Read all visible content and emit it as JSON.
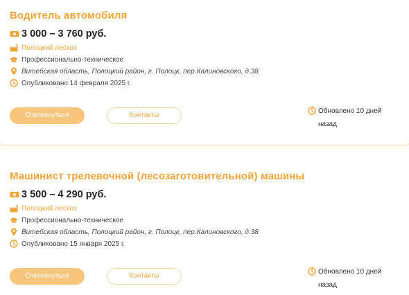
{
  "colors": {
    "accent": "#f0a53a",
    "button_fill": "#f7c57b",
    "border": "#f0d9a8"
  },
  "vacancies": [
    {
      "title": "Водитель автомобиля",
      "salary": "3 000 – 3 760 руб.",
      "company": "Полоцкий лесхоз",
      "education": "Профессионально-техническое",
      "address": "Витебская область, Полоцкий район, г. Полоцк, пер.Калиновского, д.38",
      "published": "Опубликовано 14 февраля 2025 г.",
      "apply_label": "Откликнуться",
      "contacts_label": "Контакты",
      "updated_line1": "Обновлено 10 дней",
      "updated_line2": "назад"
    },
    {
      "title": "Машинист трелевочной (лесозаготовительной) машины",
      "salary": "3 500 – 4 290 руб.",
      "company": "Полоцкий лесхоз",
      "education": "Профессионально-техническое",
      "address": "Витебская область, Полоцкий район, г. Полоцк, пер.Калиновского, д.38",
      "published": "Опубликовано 15 января 2025 г.",
      "apply_label": "Откликнуться",
      "contacts_label": "Контакты",
      "updated_line1": "Обновлено 10 дней",
      "updated_line2": "назад"
    }
  ]
}
